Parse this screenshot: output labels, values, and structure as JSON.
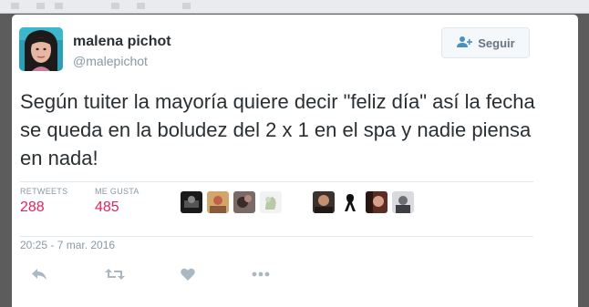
{
  "tweet": {
    "author_name": "malena pichot",
    "author_handle": "@malepichot",
    "follow_label": "Seguir",
    "text": "Según tuiter la mayoría quiere decir \"feliz día\" así la fecha se queda en la boludez del 2 x 1 en el spa y nadie piensa en nada!",
    "retweets_label": "RETWEETS",
    "retweets_count": "288",
    "likes_label": "ME GUSTA",
    "likes_count": "485",
    "timestamp": "20:25 - 7 mar. 2016"
  },
  "icons": {
    "follow": "person-plus-icon",
    "reply": "reply-icon",
    "retweet": "retweet-icon",
    "like": "heart-icon",
    "more": "more-icon"
  },
  "colors": {
    "count_color": "#e0245e",
    "muted_text": "#8899a6",
    "main_text": "#292f33",
    "icon_color": "#aab8c2"
  }
}
